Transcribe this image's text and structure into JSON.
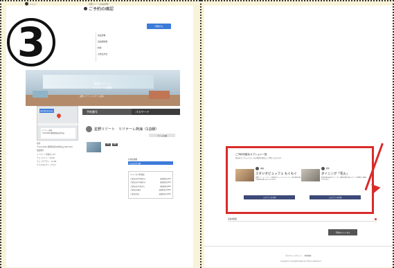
{
  "header": {
    "menu_label": "メニュー",
    "top_caption": "星野リゾートの宿泊予約",
    "page_title": "ご予約の確認",
    "print_button": "印刷する"
  },
  "step_badge": "3",
  "side_nav": [
    "宿泊日程",
    "宿泊者情報",
    "料金",
    "お支払方法"
  ],
  "hero": {
    "logo_line1": "星野リゾート",
    "logo_line2": "リゾナーレ熱海",
    "caption": "星野リゾート リゾナーレ熱海"
  },
  "booking_tabs": {
    "reservation_number": "予約番号",
    "password": "パスワード"
  },
  "map": {
    "tag": "現在地周辺を表示",
    "card_line1": "リゾナーレ熱海",
    "card_line2": "〒413-0002 静岡県熱海市伊豆山"
  },
  "hotel": {
    "name": "星野リゾート　リゾナーレ熱海（1泊朝）",
    "small_button": "プランの詳細"
  },
  "info_lines": [
    "住所",
    "〒413-0002 静岡県熱海市伊豆山1993-250",
    "電話番号",
    "リゾナーレ予約センター",
    "チェックイン：15:00",
    "チェックアウト：11:00",
    "クリスマスナイトプラン"
  ],
  "mini_tags": [
    "夕食",
    "朝食"
  ],
  "summary": {
    "label": "お支払金額",
    "bar": "お支払合計金額",
    "section": "キャンセル料規定",
    "rows": [
      [
        "ご宿泊日の30日前から",
        "宿泊料金の20%"
      ],
      [
        "ご宿泊日の14日前から",
        "宿泊料金の50%"
      ],
      [
        "ご宿泊日の7日前から",
        "宿泊料金の80%"
      ],
      [
        "ご宿泊日の前日",
        "宿泊料金の100%"
      ],
      [
        "ご宿泊日当日",
        "宿泊料金の100%"
      ]
    ]
  },
  "options": {
    "title": "ご予約可能なオプション一覧",
    "subtitle": "旅を彩るアクティビティやお食事を事前にご予約いただけます",
    "cards": [
      {
        "num": "01",
        "category": "体験",
        "name": "スタジオビュッフェ もぐもぐ",
        "desc": "星野リゾート リゾナーレ熱海のビュッフェレストラン。地元食材を使った料理をお楽しみいただけます。",
        "button": "このプランを予約"
      },
      {
        "num": "02",
        "category": "食事",
        "name": "ダイニング「花火」",
        "desc": "熱海の夜を彩るダイニング。季節の食材を使ったコース料理をご用意しております。",
        "button": "このプランを予約"
      }
    ]
  },
  "accordion": "宿泊者情報",
  "cancel_button": "予約をキャンセル",
  "footer": {
    "links": "プライバシーポリシー ｜ 利用規約",
    "copyright": "Copyright (c) All Rights Reserved. Hoshino Resorts Inc."
  }
}
